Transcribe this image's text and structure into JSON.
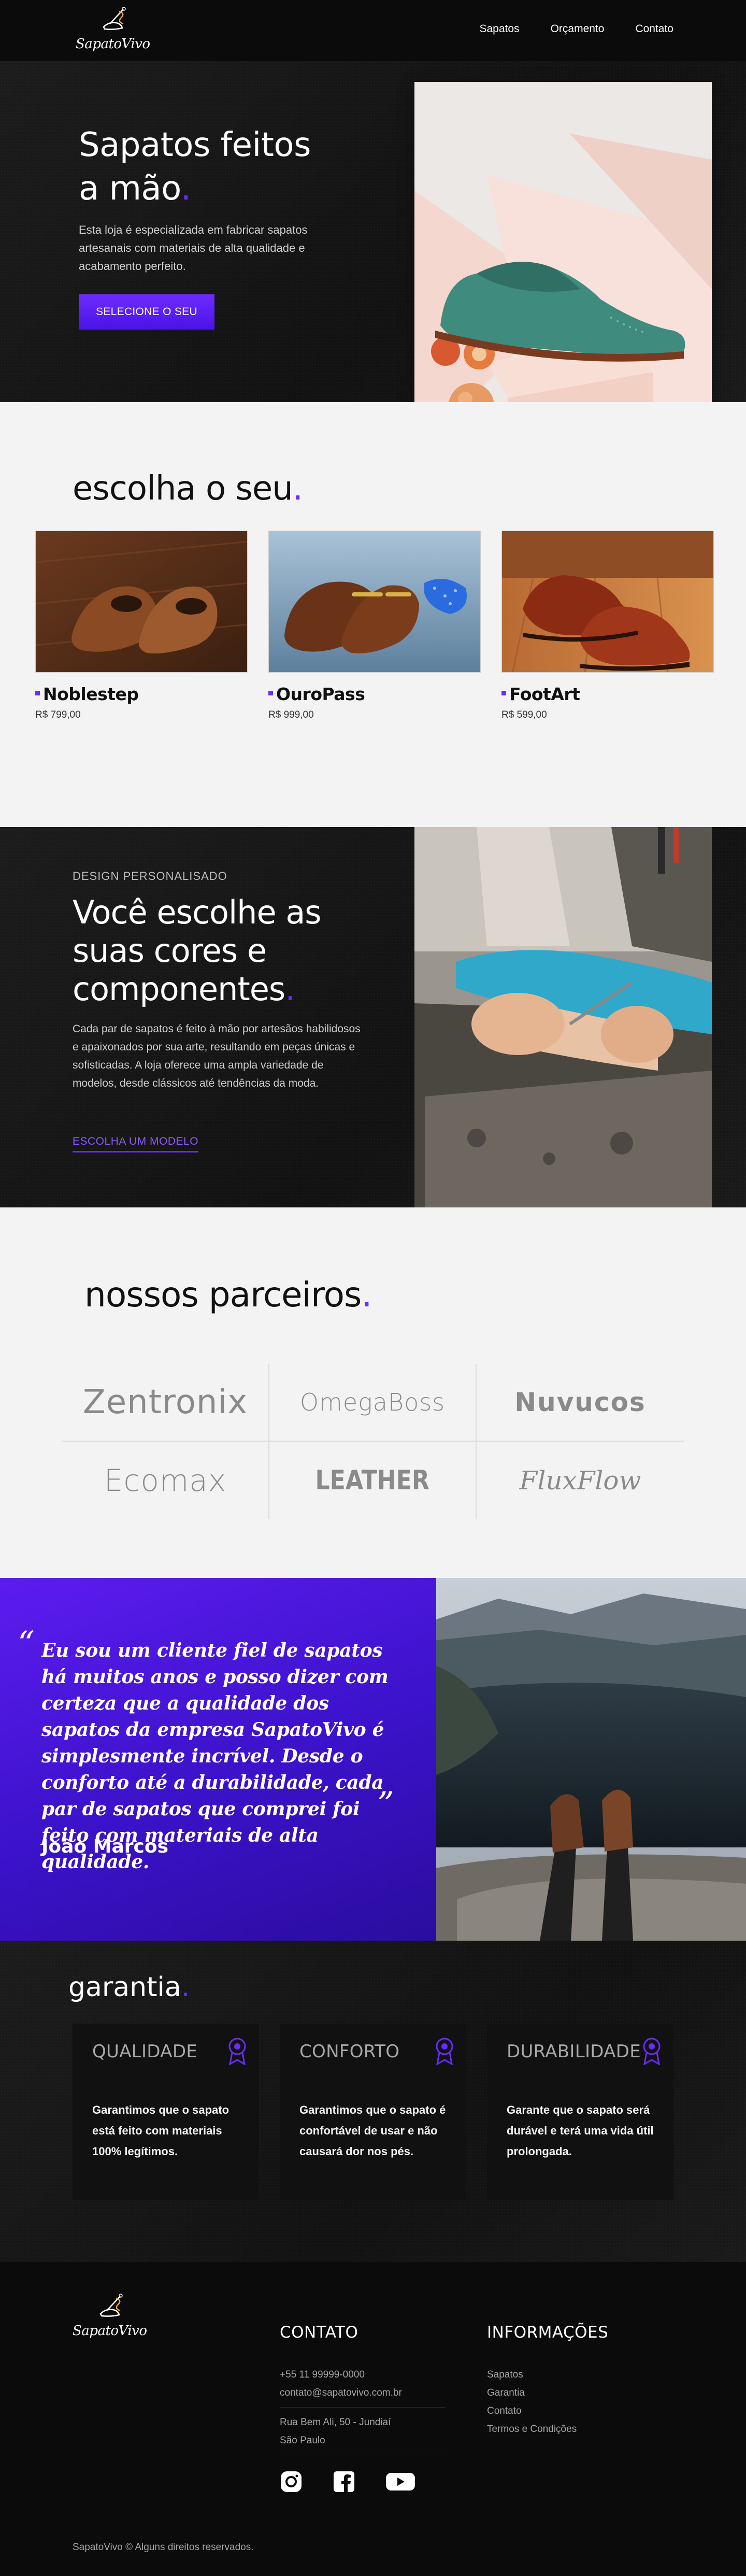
{
  "brand": {
    "name": "SapatoVivo"
  },
  "nav": {
    "items": [
      "Sapatos",
      "Orçamento",
      "Contato"
    ]
  },
  "hero": {
    "title_line1": "Sapatos feitos",
    "title_line2": "a mão",
    "title_dot": ".",
    "text": "Esta loja é especializada em fabricar sapatos artesanais com materiais de alta qualidade e acabamento perfeito.",
    "button": "SELECIONE O SEU"
  },
  "choose": {
    "title": "escolha o seu",
    "title_dot": ".",
    "products": [
      {
        "name": "Noblestep",
        "price": "R$ 799,00"
      },
      {
        "name": "OuroPass",
        "price": "R$ 999,00"
      },
      {
        "name": "FootArt",
        "price": "R$ 599,00"
      }
    ]
  },
  "design": {
    "kicker": "DESIGN PERSONALISADO",
    "title_line1": "Você escolhe as",
    "title_line2": "suas cores e",
    "title_line3": "componentes",
    "title_dot": ".",
    "text": "Cada par de sapatos é feito à mão por artesãos habilidosos e apaixonados por sua arte, resultando em peças únicas e sofisticadas. A loja oferece uma ampla variedade de modelos, desde clássicos até tendências da moda.",
    "link": "ESCOLHA UM MODELO"
  },
  "partners": {
    "title": "nossos parceiros",
    "title_dot": ".",
    "logos": [
      "Zentronix",
      "OmegaBoss",
      "Nuvucos",
      "Ecomax",
      "LEATHER",
      "FluxFlow"
    ]
  },
  "testimonial": {
    "open_quote": "“",
    "close_quote": "”",
    "quote": "Eu sou um cliente fiel de sapatos há muitos anos e posso dizer com certeza que a qualidade dos sapatos da empresa SapatoVivo é simplesmente incrível. Desde o conforto até a durabilidade, cada par de sapatos que comprei foi feito com materiais de alta qualidade.",
    "author": "João Marcos"
  },
  "guarantee": {
    "title": "garantia",
    "title_dot": ".",
    "cards": [
      {
        "title": "QUALIDADE",
        "text": "Garantimos que o sapato está feito com materiais 100% legítimos."
      },
      {
        "title": "CONFORTO",
        "text": "Garantimos que o sapato é confortável de usar e não causará dor nos pés."
      },
      {
        "title": "DURABILIDADE",
        "text": "Garante que o sapato será durável e terá uma vida útil prolongada."
      }
    ]
  },
  "footer": {
    "contact_title": "CONTATO",
    "phone": "+55 11 99999-0000",
    "email": "contato@sapatovivo.com.br",
    "address1": "Rua Bem Ali, 50 - Jundiaí",
    "address2": "São Paulo",
    "info_title": "INFORMAÇÕES",
    "info_links": [
      "Sapatos",
      "Garantia",
      "Contato",
      "Termos e Condições"
    ],
    "copyright": "SapatoVivo © Alguns direitos reservados.",
    "social_icons": [
      "instagram-icon",
      "facebook-icon",
      "youtube-icon"
    ]
  },
  "colors": {
    "accent": "#6a2bff",
    "dark": "#161616",
    "light": "#f3f3f3"
  }
}
